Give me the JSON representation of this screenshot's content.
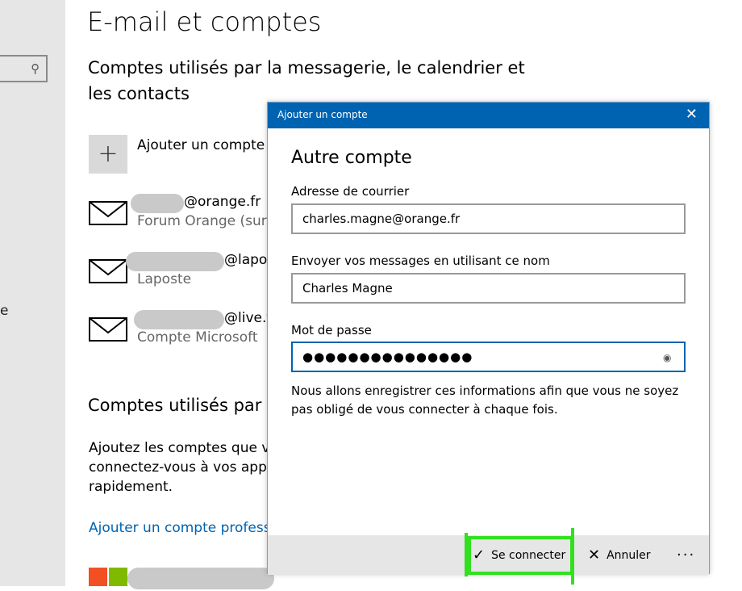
{
  "page": {
    "title": "E-mail et comptes",
    "section1_title": "Comptes utilisés par la messagerie, le calendrier et les contacts",
    "add_account_label": "Ajouter un compte",
    "accounts": [
      {
        "email": "@orange.fr",
        "subtitle": "Forum Orange (sur F"
      },
      {
        "email": "@lapos",
        "subtitle": "Laposte"
      },
      {
        "email": "@live.f",
        "subtitle": "Compte Microsoft"
      }
    ],
    "section2_title": "Comptes utilisés par",
    "section2_text": "Ajoutez les comptes que vo connectez-vous à vos applic rapidement.",
    "add_work_link": "Ajouter un compte professio",
    "left_letter": "e"
  },
  "dialog": {
    "bar_title": "Ajouter un compte",
    "close_glyph": "✕",
    "heading": "Autre compte",
    "email_label": "Adresse de courrier",
    "email_value": "charles.magne@orange.fr",
    "name_label": "Envoyer vos messages en utilisant ce nom",
    "name_value": "Charles Magne",
    "password_label": "Mot de passe",
    "password_value": "●●●●●●●●●●●●●●●",
    "note": "Nous allons enregistrer ces informations afin que vous ne soyez pas obligé de vous connecter à chaque fois.",
    "connect_label": "Se connecter",
    "cancel_label": "Annuler",
    "more_label": "···"
  },
  "icons": {
    "search": "search-icon",
    "mail": "mail-icon",
    "plus": "plus-icon",
    "eye": "eye-icon",
    "check": "check-icon",
    "close": "close-icon"
  },
  "colors": {
    "accent": "#0063b1",
    "highlight": "#32e020",
    "ms_red": "#f25022",
    "ms_green": "#7fba00"
  }
}
